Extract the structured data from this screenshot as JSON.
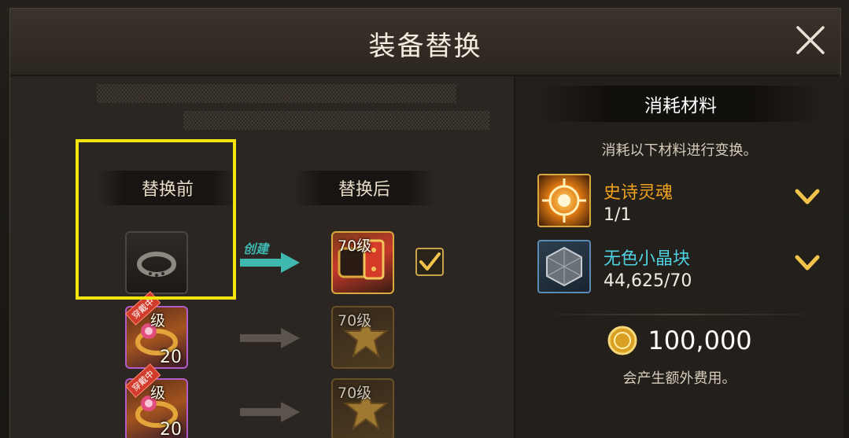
{
  "dialog": {
    "title": "装备替换",
    "close_label": "×"
  },
  "left": {
    "before_label": "替换前",
    "after_label": "替换后",
    "create_label": "创建",
    "rows": [
      {
        "before_level": "",
        "before_count": "",
        "after_level": "70级",
        "selected": true
      },
      {
        "before_level": "级",
        "before_count": "20",
        "before_tag": "穿戴中",
        "after_level": "70级",
        "selected": false
      },
      {
        "before_level": "级",
        "before_count": "20",
        "before_tag": "穿戴中",
        "after_level": "70级",
        "selected": false
      }
    ]
  },
  "materials": {
    "header": "消耗材料",
    "description": "消耗以下材料进行变换。",
    "items": [
      {
        "name": "史诗灵魂",
        "quantity": "1/1",
        "name_color": "#f0a21e",
        "icon": "epic-soul-icon"
      },
      {
        "name": "无色小晶块",
        "quantity": "44,625/70",
        "name_color": "#4fd0e0",
        "icon": "colorless-crystal-icon"
      }
    ],
    "cost_value": "100,000",
    "cost_icon": "gold-coin-icon",
    "cost_note": "会产生额外费用。"
  }
}
